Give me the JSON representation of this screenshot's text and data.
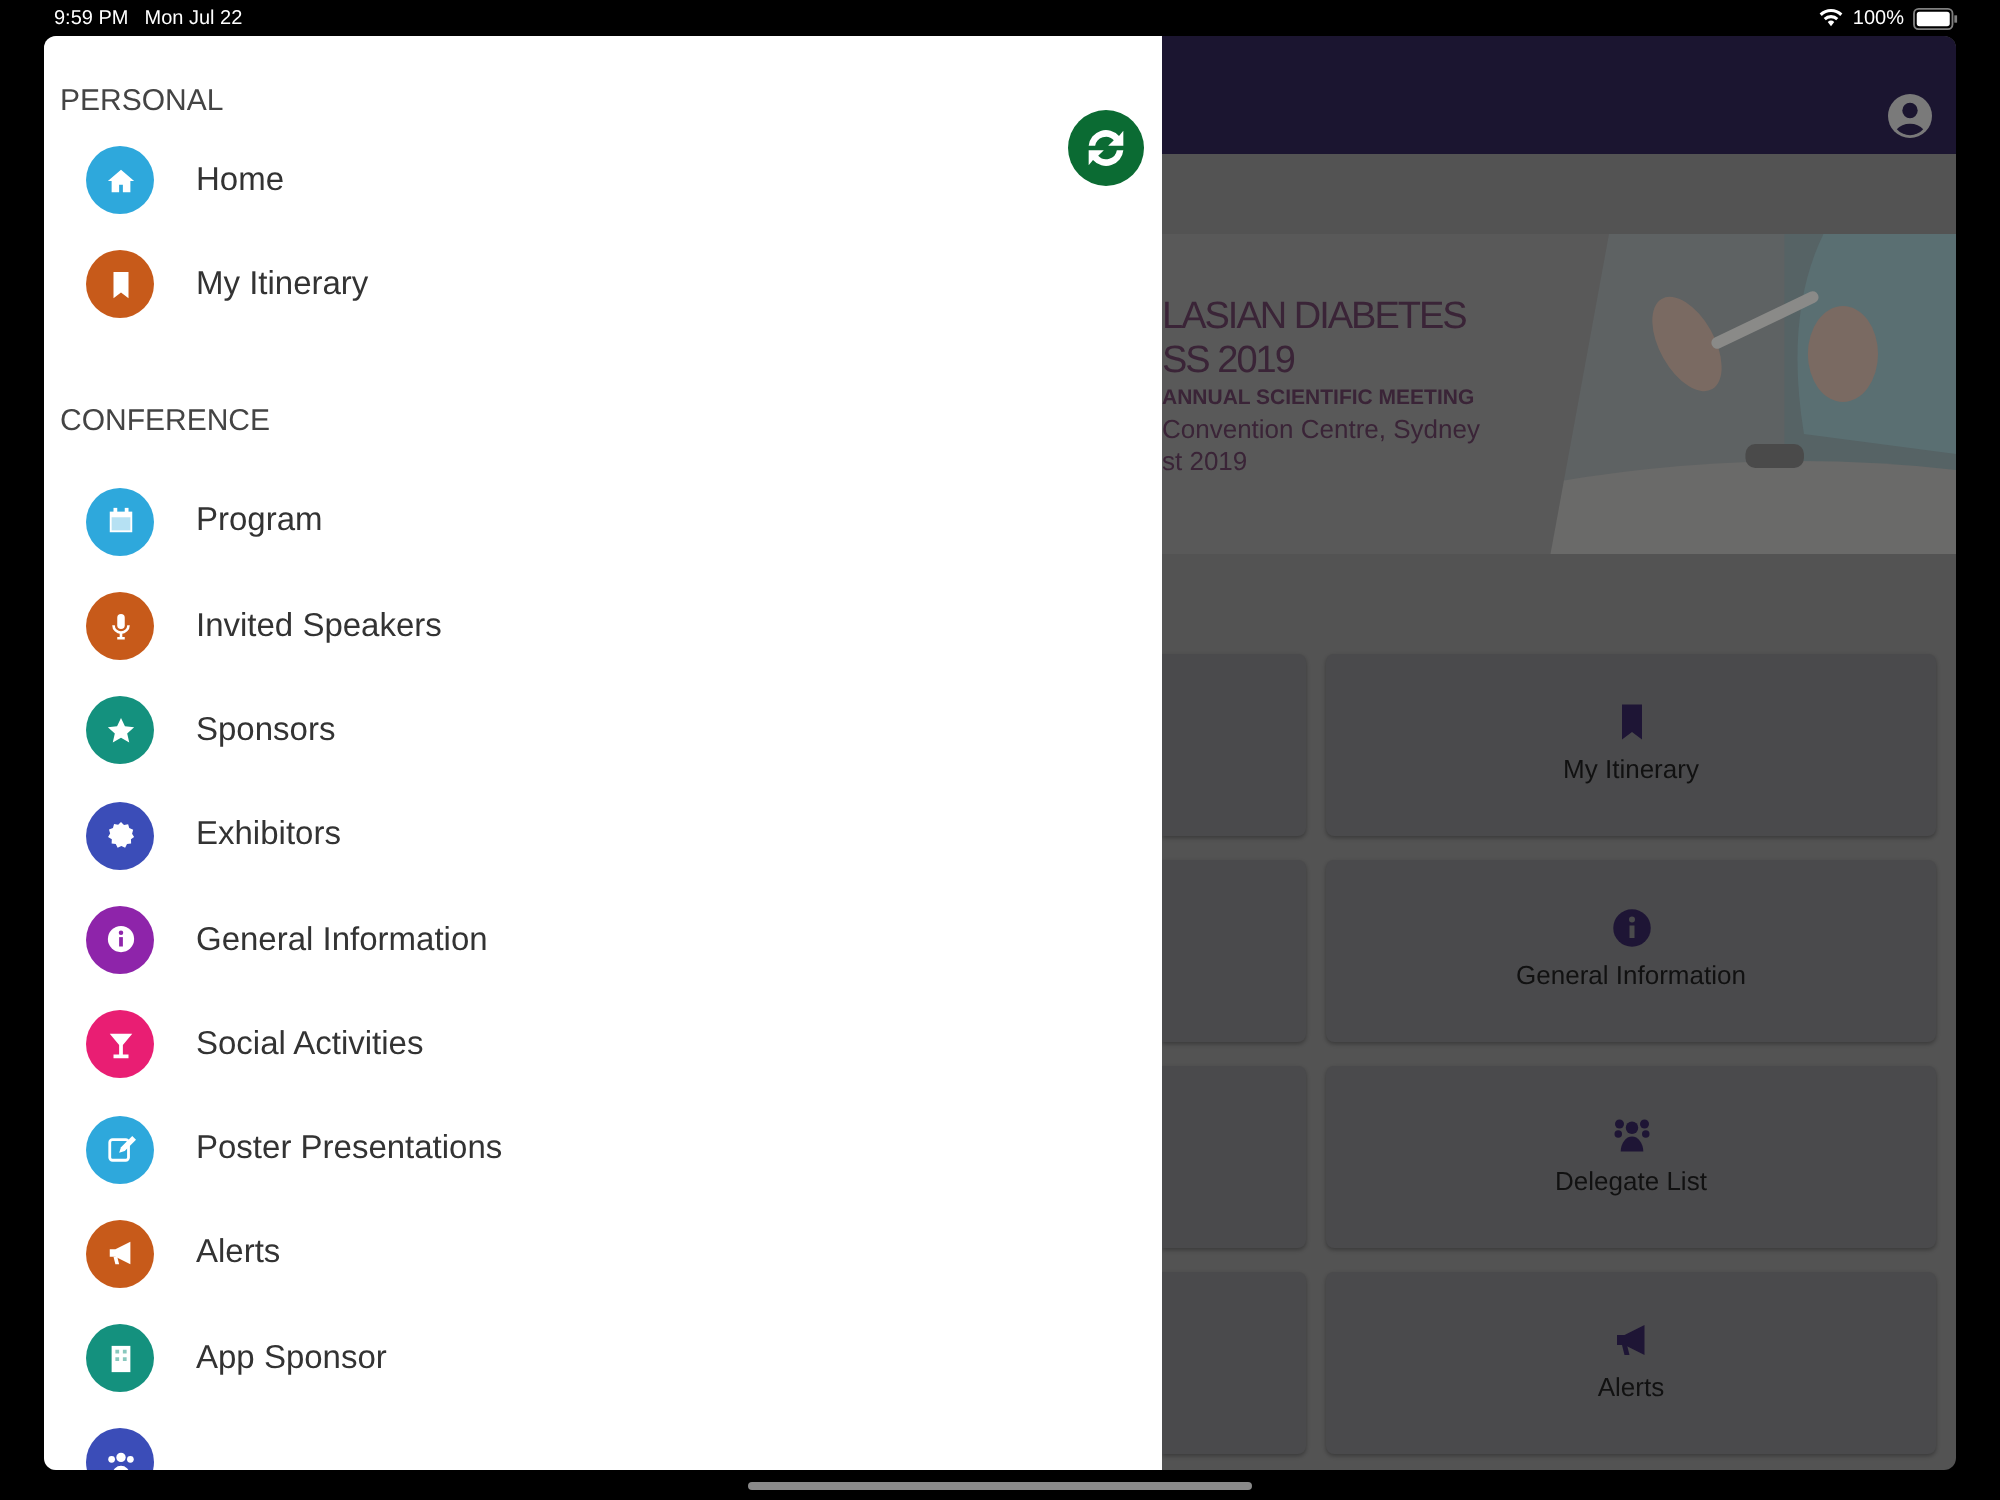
{
  "status_bar": {
    "time": "9:59 PM",
    "date": "Mon Jul 22",
    "battery": "100%"
  },
  "drawer": {
    "sections": [
      {
        "title": "PERSONAL",
        "items": [
          {
            "label": "Home",
            "color": "#2ea8dc"
          },
          {
            "label": "My Itinerary",
            "color": "#c75a1a"
          }
        ]
      },
      {
        "title": "CONFERENCE",
        "items": [
          {
            "label": "Program",
            "color": "#2ea8dc"
          },
          {
            "label": "Invited Speakers",
            "color": "#c75a1a"
          },
          {
            "label": "Sponsors",
            "color": "#14917e"
          },
          {
            "label": "Exhibitors",
            "color": "#3b4db8"
          },
          {
            "label": "General Information",
            "color": "#8e24aa"
          },
          {
            "label": "Social Activities",
            "color": "#e91e73"
          },
          {
            "label": "Poster Presentations",
            "color": "#2ea8dc"
          },
          {
            "label": "Alerts",
            "color": "#c75a1a"
          },
          {
            "label": "App Sponsor",
            "color": "#14917e"
          },
          {
            "color": "#3b4db8"
          }
        ]
      }
    ]
  },
  "banner": {
    "lines": [
      "LASIAN DIABETES",
      "SS 2019",
      "ANNUAL SCIENTIFIC MEETING",
      "Convention Centre, Sydney",
      "st 2019"
    ]
  },
  "tiles": [
    {
      "label": "My Itinerary"
    },
    {
      "label": "General Information"
    },
    {
      "label": "Delegate List"
    },
    {
      "label": "Alerts"
    }
  ]
}
